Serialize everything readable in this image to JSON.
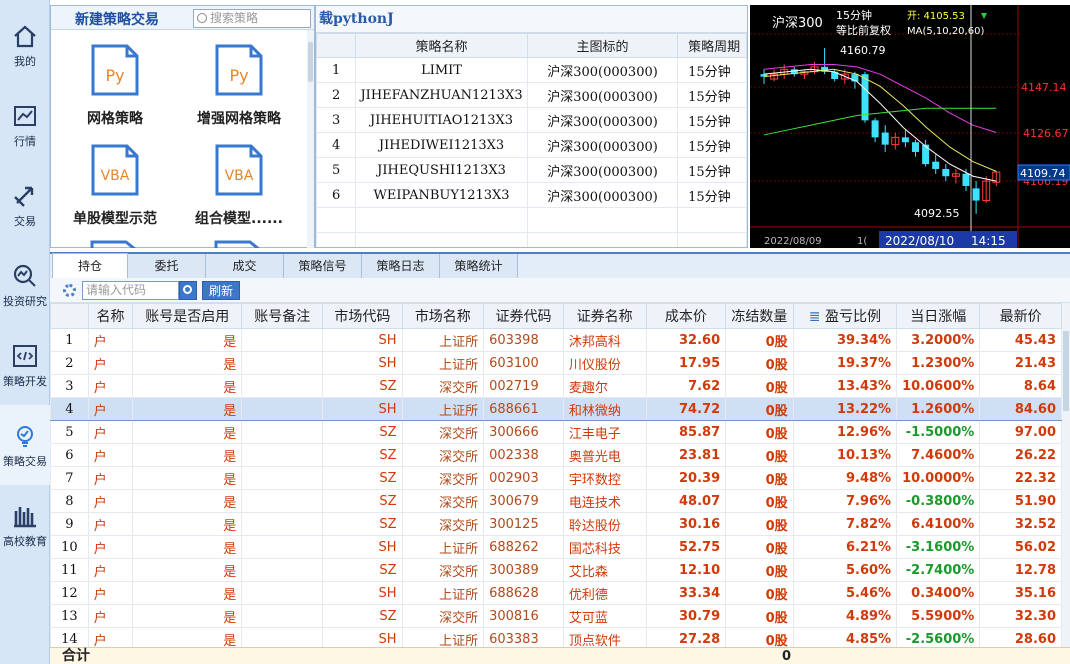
{
  "sidebar": {
    "items": [
      {
        "label": "我的",
        "icon": "home-icon"
      },
      {
        "label": "行情",
        "icon": "chart-icon"
      },
      {
        "label": "交易",
        "icon": "transfer-icon"
      },
      {
        "label": "投资研究",
        "icon": "research-icon"
      },
      {
        "label": "策略开发",
        "icon": "code-icon"
      },
      {
        "label": "策略交易",
        "icon": "bulb-icon"
      },
      {
        "label": "高校教育",
        "icon": "books-icon"
      }
    ]
  },
  "strategy_panel": {
    "new_label": "新建策略交易",
    "search_placeholder": "搜索策略",
    "files": [
      {
        "badge": "Py",
        "name": "网格策略"
      },
      {
        "badge": "Py",
        "name": "增强网格策略"
      },
      {
        "badge": "VBA",
        "name": "单股模型示范"
      },
      {
        "badge": "VBA",
        "name": "组合模型......"
      }
    ]
  },
  "strategy_table": {
    "title": "载pythonJ",
    "headers": [
      "",
      "策略名称",
      "主图标的",
      "策略周期"
    ],
    "rows": [
      [
        "1",
        "LIMIT",
        "沪深300(000300)",
        "15分钟"
      ],
      [
        "2",
        "JIHEFANZHUAN1213X3",
        "沪深300(000300)",
        "15分钟"
      ],
      [
        "3",
        "JIHEHUITIAO1213X3",
        "沪深300(000300)",
        "15分钟"
      ],
      [
        "4",
        "JIHEDIWEI1213X3",
        "沪深300(000300)",
        "15分钟"
      ],
      [
        "5",
        "JIHEQUSHI1213X3",
        "沪深300(000300)",
        "15分钟"
      ],
      [
        "6",
        "WEIPANBUY1213X3",
        "沪深300(000300)",
        "15分钟"
      ]
    ]
  },
  "kline": {
    "symbol": "沪深300",
    "period": "15分钟",
    "adjust": "等比前复权",
    "open_label": "开: 4105.53",
    "ma_label": "MA(5,10,20,60)",
    "high_label": "4160.79",
    "low_label": "4092.55",
    "price_labels": [
      "4147.14",
      "4126.67",
      "4106.19"
    ],
    "current_price": "4109.74",
    "date_left": "2022/08/09",
    "date_mid": "1(",
    "date_cursor": "2022/08/10",
    "time_cursor": "14:15",
    "colors": {
      "up": "#ff4040",
      "down": "#40e0ff",
      "ma5": "#ffffff",
      "ma10": "#e8e860",
      "ma20": "#e040e0",
      "ma60": "#40e040"
    }
  },
  "bottom_tabs": [
    "持仓",
    "委托",
    "成交",
    "策略信号",
    "策略日志",
    "策略统计"
  ],
  "toolbar": {
    "code_placeholder": "请输入代码",
    "refresh_label": "刷新"
  },
  "holdings": {
    "headers": [
      "",
      "名称",
      "账号是否启用",
      "账号备注",
      "市场代码",
      "市场名称",
      "证券代码",
      "证券名称",
      "成本价",
      "冻结数量",
      "盈亏比例",
      "当日涨幅",
      "最新价"
    ],
    "rows": [
      [
        "1",
        "户",
        "是",
        "",
        "SH",
        "上证所",
        "603398",
        "沐邦高科",
        "32.60",
        "0股",
        "39.34%",
        "3.2000%",
        "45.43"
      ],
      [
        "2",
        "户",
        "是",
        "",
        "SH",
        "上证所",
        "603100",
        "川仪股份",
        "17.95",
        "0股",
        "19.37%",
        "1.2300%",
        "21.43"
      ],
      [
        "3",
        "户",
        "是",
        "",
        "SZ",
        "深交所",
        "002719",
        "麦趣尔",
        "7.62",
        "0股",
        "13.43%",
        "10.0600%",
        "8.64"
      ],
      [
        "4",
        "户",
        "是",
        "",
        "SH",
        "上证所",
        "688661",
        "和林微纳",
        "74.72",
        "0股",
        "13.22%",
        "1.2600%",
        "84.60"
      ],
      [
        "5",
        "户",
        "是",
        "",
        "SZ",
        "深交所",
        "300666",
        "江丰电子",
        "85.87",
        "0股",
        "12.96%",
        "-1.5000%",
        "97.00"
      ],
      [
        "6",
        "户",
        "是",
        "",
        "SZ",
        "深交所",
        "002338",
        "奥普光电",
        "23.81",
        "0股",
        "10.13%",
        "7.4600%",
        "26.22"
      ],
      [
        "7",
        "户",
        "是",
        "",
        "SZ",
        "深交所",
        "002903",
        "宇环数控",
        "20.39",
        "0股",
        "9.48%",
        "10.0000%",
        "22.32"
      ],
      [
        "8",
        "户",
        "是",
        "",
        "SZ",
        "深交所",
        "300679",
        "电连技术",
        "48.07",
        "0股",
        "7.96%",
        "-0.3800%",
        "51.90"
      ],
      [
        "9",
        "户",
        "是",
        "",
        "SZ",
        "深交所",
        "300125",
        "聆达股份",
        "30.16",
        "0股",
        "7.82%",
        "6.4100%",
        "32.52"
      ],
      [
        "10",
        "户",
        "是",
        "",
        "SH",
        "上证所",
        "688262",
        "国芯科技",
        "52.75",
        "0股",
        "6.21%",
        "-3.1600%",
        "56.02"
      ],
      [
        "11",
        "户",
        "是",
        "",
        "SZ",
        "深交所",
        "300389",
        "艾比森",
        "12.10",
        "0股",
        "5.60%",
        "-2.7400%",
        "12.78"
      ],
      [
        "12",
        "户",
        "是",
        "",
        "SH",
        "上证所",
        "688628",
        "优利德",
        "33.34",
        "0股",
        "5.46%",
        "0.3400%",
        "35.16"
      ],
      [
        "13",
        "户",
        "是",
        "",
        "SZ",
        "深交所",
        "300816",
        "艾可蓝",
        "30.79",
        "0股",
        "4.89%",
        "5.5900%",
        "32.30"
      ],
      [
        "14",
        "户",
        "是",
        "",
        "SH",
        "上证所",
        "603383",
        "顶点软件",
        "27.28",
        "0股",
        "4.85%",
        "-2.5600%",
        "28.60"
      ]
    ],
    "selected_row": 4
  },
  "summary": {
    "label": "合计",
    "frozen_total": "0"
  }
}
